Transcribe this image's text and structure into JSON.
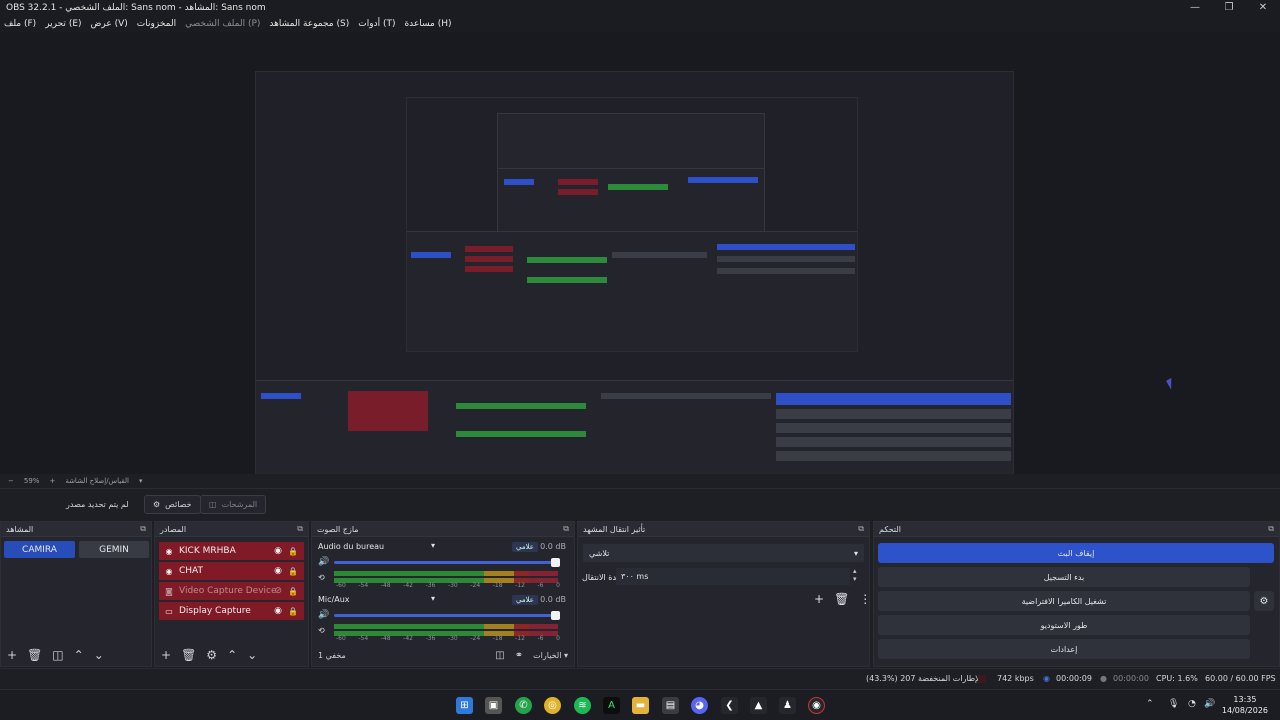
{
  "window": {
    "title": "OBS 32.2.1 - الملف الشخصي: Sans nom - المشاهد: Sans nom"
  },
  "menu": [
    {
      "label": "ملف (F)",
      "dim": false
    },
    {
      "label": "تحرير (E)",
      "dim": false
    },
    {
      "label": "عرض (V)",
      "dim": false
    },
    {
      "label": "المخزونات",
      "dim": false
    },
    {
      "label": "الملف الشخصي (P)",
      "dim": true
    },
    {
      "label": "مجموعة المشاهد (S)",
      "dim": false
    },
    {
      "label": "أدوات (T)",
      "dim": false
    },
    {
      "label": "مساعدة (H)",
      "dim": false
    }
  ],
  "zoom": {
    "percent": "59%",
    "label": "القياس/إصلاح الشاشة"
  },
  "toolbar": {
    "no_source": "لم يتم تحديد مصدر",
    "properties": "خصائص",
    "filters": "المرشحات"
  },
  "scenes": {
    "title": "المشاهد",
    "items": [
      "CAMIRA",
      "GEMIN"
    ],
    "active": 0
  },
  "sources": {
    "title": "المصادر",
    "items": [
      {
        "name": "KICK MRHBA",
        "icon": "browser-icon",
        "dim": false
      },
      {
        "name": "CHAT",
        "icon": "browser-icon",
        "dim": false
      },
      {
        "name": "Video Capture Device",
        "icon": "camera-icon",
        "dim": true
      },
      {
        "name": "Display Capture",
        "icon": "monitor-icon",
        "dim": false
      }
    ]
  },
  "mixer": {
    "title": "مازج الصوت",
    "tracks": [
      {
        "name": "Audio du bureau",
        "db": "0.0 dB",
        "button": "علامي"
      },
      {
        "name": "Mic/Aux",
        "db": "0.0 dB",
        "button": "علامي"
      }
    ],
    "scale": [
      "-60",
      "-54",
      "-48",
      "-42",
      "-36",
      "-30",
      "-24",
      "-18",
      "-12",
      "-6",
      "0"
    ],
    "footer_left": "مخفي 1",
    "footer_options": "الخيارات"
  },
  "transitions": {
    "title": "تأثير انتقال المشهد",
    "selected": "تلاشي",
    "duration_label": "مدة الانتقال",
    "duration_value": "٣٠٠ ms"
  },
  "controls": {
    "title": "التحكم",
    "start_stream": "إيقاف البث",
    "start_record": "بدء التسجيل",
    "virtual_cam": "تشغيل الكاميرا الافتراضية",
    "studio": "طور الاستوديو",
    "settings": "إعدادات"
  },
  "status": {
    "dropped": "الإطارات المنخفضة 207 (%43.3)",
    "bitrate": "742 kbps",
    "stream_time": "00:00:09",
    "rec_time": "00:00:00",
    "cpu": "CPU: 1.6%",
    "fps": "60.00 / 60.00 FPS"
  },
  "clock": {
    "time": "13:35",
    "date": "14/08/2026"
  },
  "colors": {
    "accent": "#2e52c9",
    "source_bg": "#801a27",
    "meter_green": "#2c8a36"
  }
}
